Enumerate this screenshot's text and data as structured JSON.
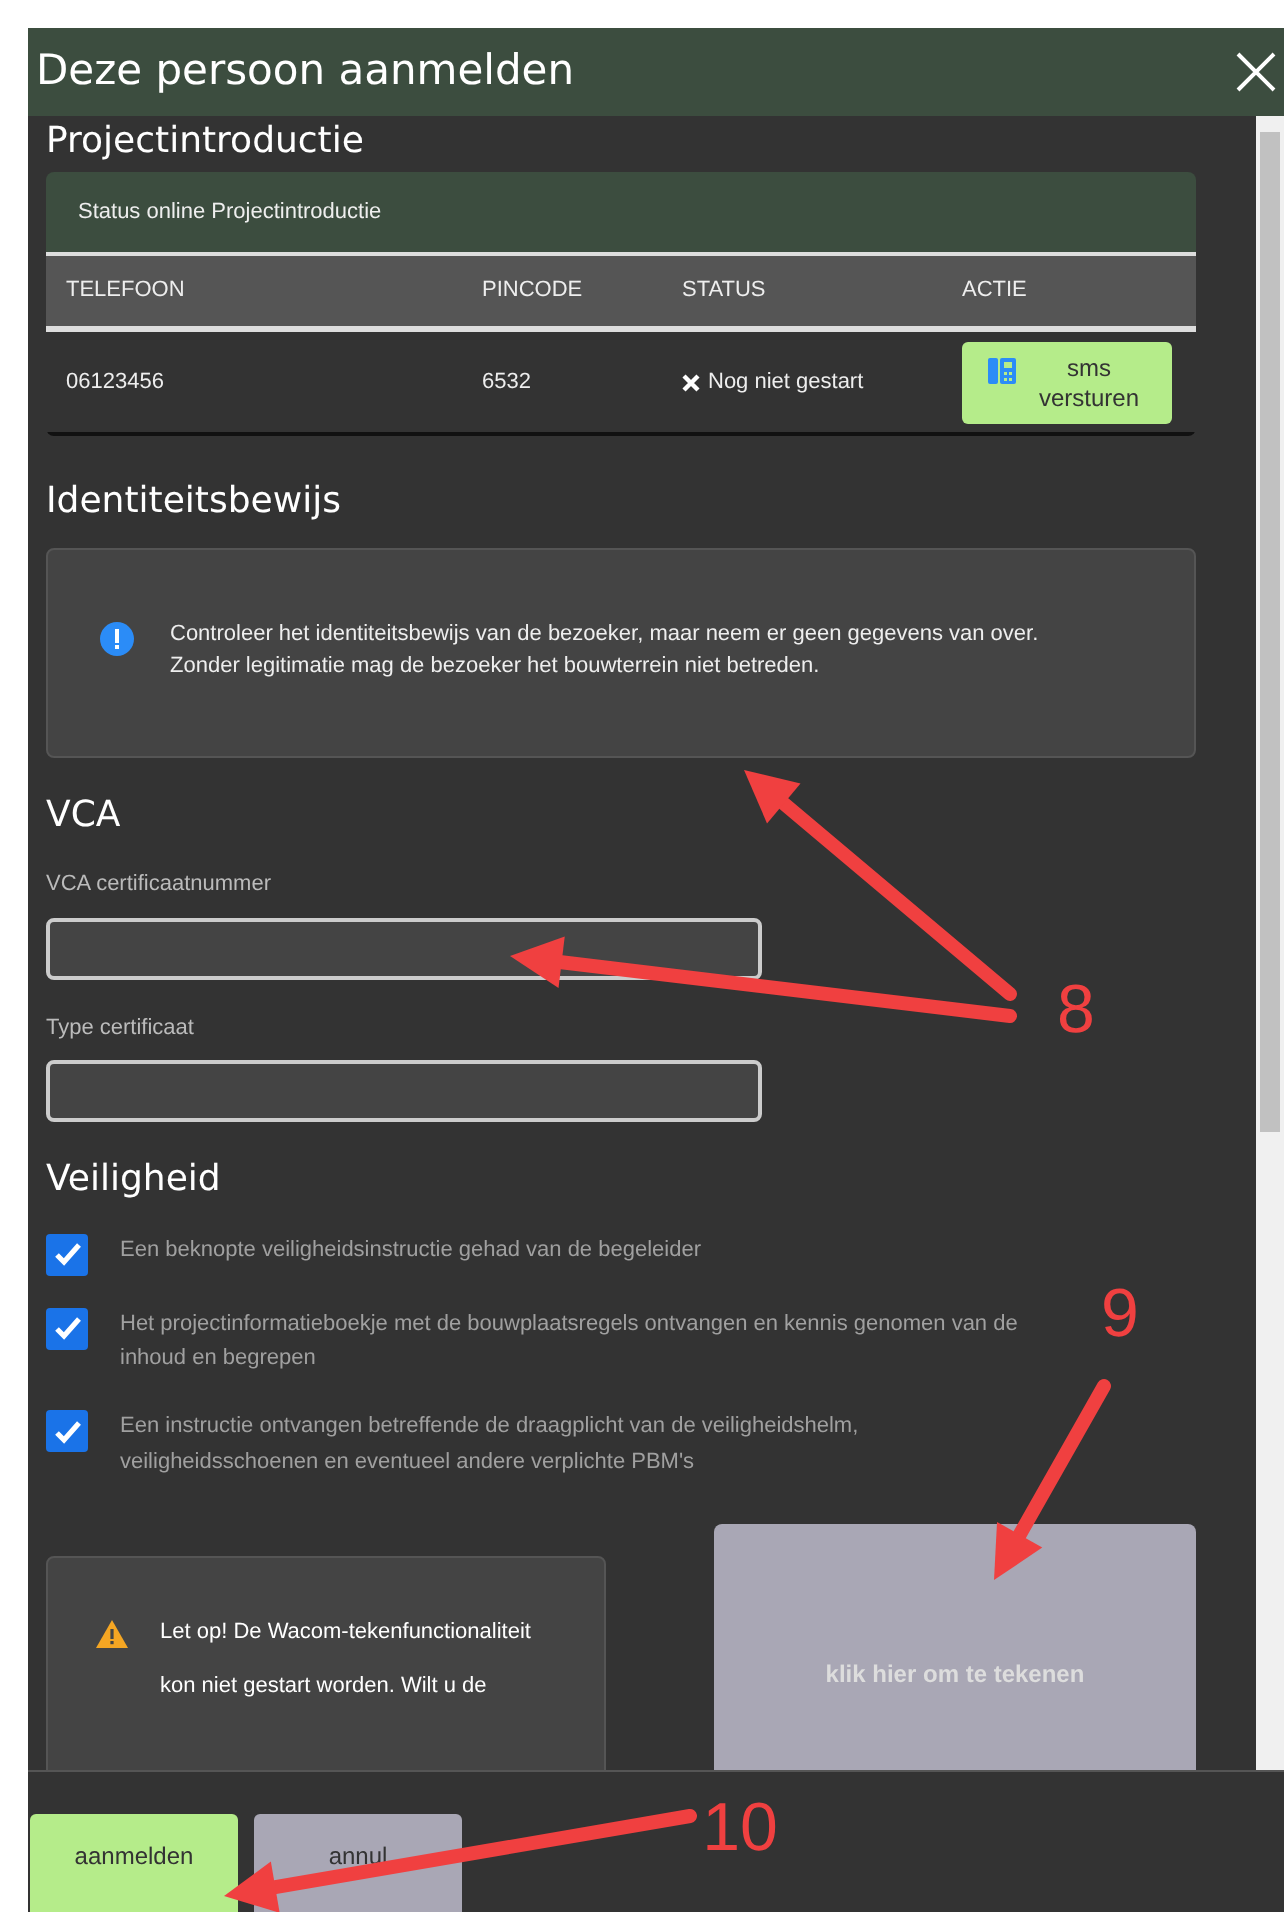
{
  "dialog_title": "Deze persoon aanmelden",
  "projectintroductie": {
    "heading": "Projectintroductie",
    "card_title": "Status online Projectintroductie",
    "columns": [
      "TELEFOON",
      "PINCODE",
      "STATUS",
      "ACTIE"
    ],
    "rows": [
      {
        "telefoon": "06123456",
        "pincode": "6532",
        "status": "Nog niet gestart",
        "action": "sms versturen"
      }
    ]
  },
  "identiteitsbewijs": {
    "heading": "Identiteitsbewijs",
    "notice_lines": [
      "Controleer het identiteitsbewijs van de bezoeker, maar neem er geen gegevens van over.",
      "Zonder legitimatie mag de bezoeker het bouwterrein niet betreden."
    ]
  },
  "vca": {
    "heading": "VCA",
    "fields": [
      {
        "label": "VCA certificaatnummer"
      },
      {
        "label": "Type certificaat"
      }
    ]
  },
  "veiligheid": {
    "heading": "Veiligheid",
    "checks": [
      {
        "label": "Een beknopte veiligheidsinstructie gehad van de begeleider",
        "checked": true
      },
      {
        "label": "Het projectinformatieboekje met de bouwplaatsregels ontvangen en kennis genomen van de inhoud en begrepen",
        "checked": true
      },
      {
        "label": "Een instructie ontvangen betreffende de draagplicht van de veiligheidshelm, veiligheidsschoenen en eventueel andere verplichte PBM's",
        "checked": true
      }
    ]
  },
  "signature": {
    "warning": "Let op! De Wacom-tekenfunctionaliteit kon niet gestart worden. Wilt u de",
    "pad_label": "klik hier om te tekenen"
  },
  "footer_buttons": [
    {
      "label": "aanmelden",
      "kind": "primary"
    },
    {
      "label": "annul",
      "kind": "secondary"
    }
  ],
  "annotations": [
    {
      "label": "8"
    },
    {
      "label": "9"
    },
    {
      "label": "10"
    }
  ]
}
